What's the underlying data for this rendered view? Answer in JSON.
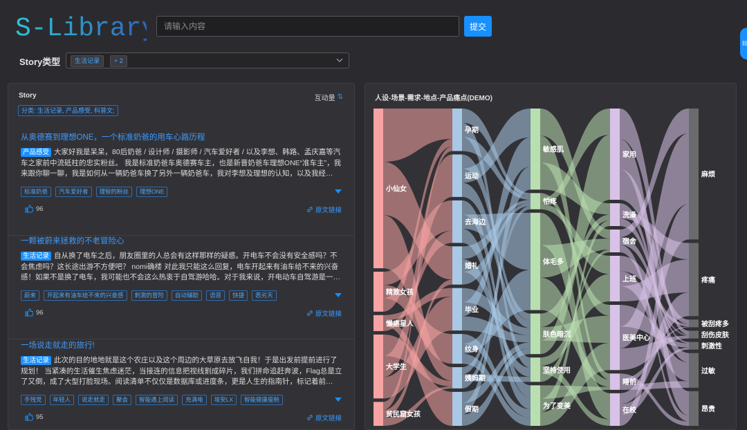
{
  "header": {
    "logo_text": "S-Library",
    "search_placeholder": "请输入内容",
    "submit_label": "提交",
    "side_handle": "III"
  },
  "filter": {
    "label": "Story类型",
    "selected": "生活记录",
    "more": "+ 2"
  },
  "story_panel": {
    "title": "Story",
    "sort_label": "互动量",
    "category_filter": "分类: 生活记录, 产品感受, 科普文;",
    "link_label": "原文链接",
    "stories": [
      {
        "title": "从奥德赛到理想ONE，一个标准奶爸的用车心路历程",
        "category": "产品感受",
        "text": "大家好我是呆呆，80后奶爸 / 设计师 / 摄影师 / 汽车爱好者 / 以及李想、韩路、孟庆嘉等汽车之家前中流砥柱的忠实粉丝。 我是标准奶爸车奥德赛车主，也是新晋奶爸车理想ONE“准车主”，我来跟你聊一聊，我是如何从一辆奶爸车换了另外一辆奶爸车，我对李想及理想的认知，以及我经…",
        "tags": [
          "标准奶爸",
          "汽车爱好者",
          "理智的粉丝",
          "理想ONE"
        ],
        "likes": "96"
      },
      {
        "title": "一颗被蔚来拯救的不老冒险心",
        "category": "生活记录",
        "text": "自从换了电车之后，朋友圈里的人总会有这样那样的疑惑。开电车不会没有安全感吗？不会焦虑吗？这长途出游不方便吧？ nomi确楼 对此我只能这么回复，电车开起来有油车给不来的兴奋感！如果不是换了电车，我可能也不会这么热衷于自驾游哈哈。对于我来说，开电动车自驾游是一…",
        "tags": [
          "蔚来",
          "开起来有油车给不来的兴奋感",
          "刺激的冒险",
          "自动辅助",
          "语音",
          "快捷",
          "恶劣天"
        ],
        "likes": "96"
      },
      {
        "title": "一场说走就走的旅行!",
        "category": "生活记录",
        "text": "此次的目的地地就是这个农庄以及这个周边的大草原去放飞自我！于是出发前提前进行了规划！ 当紧凑的生活催生焦虑迷茫，当接连的信息把视线割成碎片，我们拼命追赶奔波，Flag总是立了又倒，成了大型打脸现场。阅读清单不仅仅是数据库或进度条，更是人生的指南针，标记着前…",
        "tags": [
          "手残党",
          "年轻人",
          "说走就走",
          "聚会",
          "智能遇上阅读",
          "充满电",
          "埃安LX",
          "智能健康座舱"
        ],
        "likes": "95"
      }
    ]
  },
  "chart_panel": {
    "title": "人设-场景-需求-地点-产品痛点(DEMO)"
  },
  "chart_data": {
    "type": "sankey",
    "title": "人设-场景-需求-地点-产品痛点(DEMO)",
    "columns": [
      {
        "name": "人设",
        "nodes": [
          "小仙女",
          "精致女孩",
          "懒癌星人",
          "大学生",
          "贫民窟女孩"
        ],
        "colors": [
          "#f5a3a3",
          "#f5a3a3",
          "#f5a3a3",
          "#f5a3a3",
          "#f5a3a3"
        ]
      },
      {
        "name": "场景",
        "nodes": [
          "孕期",
          "运动",
          "去海边",
          "婚礼",
          "毕业",
          "纹身",
          "姨妈期",
          "假期"
        ],
        "colors": [
          "#a8c8e6",
          "#a8c8e6",
          "#a8c8e6",
          "#a8c8e6",
          "#a8c8e6",
          "#a8c8e6",
          "#a8c8e6",
          "#a8c8e6"
        ]
      },
      {
        "name": "需求",
        "nodes": [
          "敏感肌",
          "怕疼",
          "体毛多",
          "肤色暗沉",
          "坚持使用",
          "为了变美"
        ],
        "colors": [
          "#b9dfb0",
          "#b9dfb0",
          "#b9dfb0",
          "#b9dfb0",
          "#b9dfb0",
          "#b9dfb0"
        ]
      },
      {
        "name": "地点",
        "nodes": [
          "家用",
          "洗澡",
          "宿舍",
          "上班",
          "医美中心",
          "睡前",
          "在校"
        ],
        "colors": [
          "#d9c2e8",
          "#d9c2e8",
          "#d9c2e8",
          "#d9c2e8",
          "#d9c2e8",
          "#d9c2e8",
          "#d9c2e8"
        ]
      },
      {
        "name": "产品痛点",
        "nodes": [
          "麻烦",
          "疼痛",
          "被刮疼多",
          "刮伤皮肤",
          "刺激性",
          "过敏",
          "昂贵"
        ],
        "colors": [
          "#6b6b6e",
          "#6b6b6e",
          "#6b6b6e",
          "#6b6b6e",
          "#6b6b6e",
          "#6b6b6e",
          "#6b6b6e"
        ]
      }
    ],
    "node_values": [
      [
        40,
        10,
        4,
        16,
        6
      ],
      [
        10,
        10,
        10,
        9,
        10,
        7,
        5,
        8
      ],
      [
        20,
        4,
        24,
        10,
        6,
        10
      ],
      [
        28,
        7,
        7,
        14,
        20,
        5,
        10
      ],
      [
        34,
        19,
        2,
        2,
        2,
        9,
        9
      ]
    ],
    "link_opacity": 0.55
  }
}
